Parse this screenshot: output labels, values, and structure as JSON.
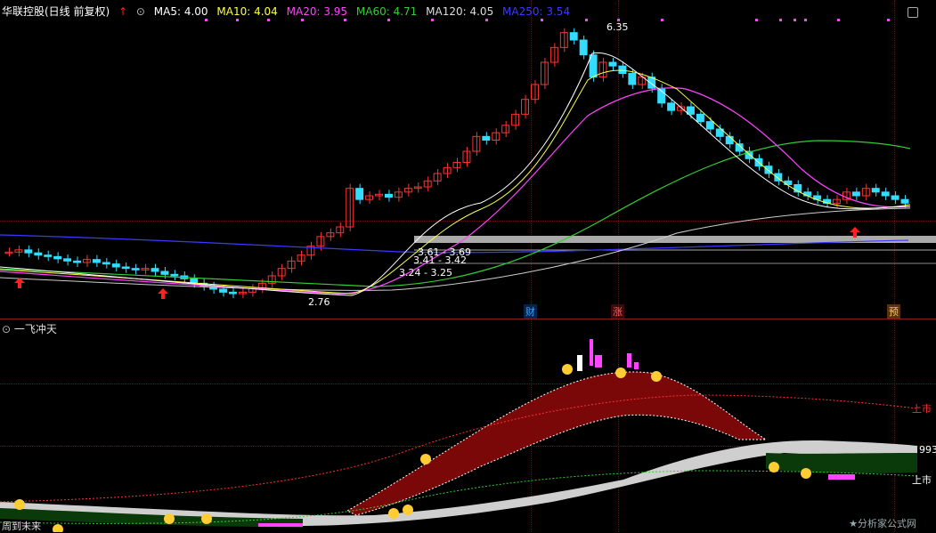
{
  "header": {
    "title": "华联控股(日线 前复权)",
    "ma": [
      {
        "label": "MA5: 4.00",
        "color": "#ffffff"
      },
      {
        "label": "MA10: 4.04",
        "color": "#ffff44"
      },
      {
        "label": "MA20: 3.95",
        "color": "#ff44ff"
      },
      {
        "label": "MA60: 4.71",
        "color": "#33cc33"
      },
      {
        "label": "MA120: 4.05",
        "color": "#dddddd"
      },
      {
        "label": "MA250: 3.54",
        "color": "#3a3aff"
      }
    ]
  },
  "indicator_title": "一飞冲天",
  "annotations": {
    "high": "6.35",
    "low": "2.76",
    "lv1": "3.61 - 3.69",
    "lv2": "3.41 - 3.42",
    "lv3": "3.24 - 3.25",
    "evt_cai": "财",
    "evt_zhang": "涨",
    "evt_yu": "预",
    "right_top": "上市",
    "right_num": "993",
    "right_bot": "上市",
    "left_bottom": "周到未来",
    "watermark": "★分析家公式网"
  },
  "colors": {
    "up": "#ff3333",
    "down": "#33ddff",
    "bg": "#000000"
  },
  "chart_data": {
    "type": "candlestick",
    "title": "华联控股(日线 前复权)",
    "xlabel": "",
    "ylabel": "",
    "ylim": [
      2.6,
      6.5
    ],
    "series": [
      {
        "name": "MA5",
        "value": 4.0
      },
      {
        "name": "MA10",
        "value": 4.04
      },
      {
        "name": "MA20",
        "value": 3.95
      },
      {
        "name": "MA60",
        "value": 4.71
      },
      {
        "name": "MA120",
        "value": 4.05
      },
      {
        "name": "MA250",
        "value": 3.54
      }
    ],
    "close": [
      3.34,
      3.37,
      3.33,
      3.3,
      3.28,
      3.25,
      3.22,
      3.2,
      3.24,
      3.2,
      3.18,
      3.14,
      3.12,
      3.1,
      3.12,
      3.08,
      3.04,
      3.02,
      2.98,
      2.92,
      2.88,
      2.84,
      2.8,
      2.78,
      2.8,
      2.85,
      2.92,
      3.02,
      3.12,
      3.22,
      3.3,
      3.42,
      3.55,
      3.6,
      3.68,
      4.2,
      4.05,
      4.1,
      4.12,
      4.08,
      4.15,
      4.2,
      4.22,
      4.3,
      4.4,
      4.48,
      4.55,
      4.7,
      4.9,
      4.85,
      4.95,
      5.05,
      5.2,
      5.4,
      5.6,
      5.9,
      6.1,
      6.3,
      6.2,
      6.0,
      5.7,
      5.9,
      5.85,
      5.75,
      5.6,
      5.7,
      5.55,
      5.35,
      5.25,
      5.3,
      5.2,
      5.1,
      5.0,
      4.9,
      4.8,
      4.7,
      4.6,
      4.5,
      4.4,
      4.3,
      4.25,
      4.15,
      4.1,
      4.05,
      4.0,
      4.05,
      4.15,
      4.1,
      4.2,
      4.15,
      4.1,
      4.05,
      4.0
    ],
    "x_events": [
      "财",
      "涨",
      "预"
    ]
  }
}
